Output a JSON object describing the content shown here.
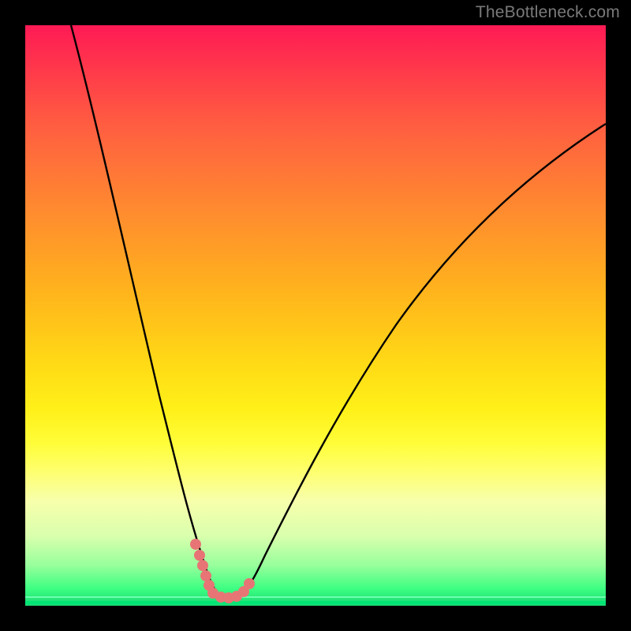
{
  "watermark": "TheBottleneck.com",
  "colors": {
    "curve_stroke": "#000000",
    "marker_fill": "#e77575",
    "background_black": "#000000"
  },
  "chart_data": {
    "type": "line",
    "title": "",
    "xlabel": "",
    "ylabel": "",
    "xlim": [
      0,
      100
    ],
    "ylim": [
      0,
      100
    ],
    "grid": false,
    "legend": false,
    "annotations": [],
    "description": "Bottleneck curve: a V-shaped black curve over a vertical gradient from red (top=high bottleneck) through yellow to green (bottom=optimal). Minimum marked with pink/red segments near x≈34.",
    "series": [
      {
        "name": "left-branch",
        "x": [
          8,
          10,
          12,
          15,
          18,
          20,
          22,
          24,
          26,
          28,
          30,
          31
        ],
        "y": [
          100,
          92,
          83,
          70,
          57,
          48,
          39,
          30,
          21,
          13,
          6,
          3
        ]
      },
      {
        "name": "right-branch",
        "x": [
          37,
          38,
          40,
          43,
          47,
          52,
          58,
          65,
          73,
          82,
          92,
          100
        ],
        "y": [
          3,
          5,
          9,
          15,
          23,
          32,
          42,
          52,
          61,
          70,
          78,
          83
        ]
      },
      {
        "name": "left-markers",
        "x": [
          29.5,
          30.2,
          30.8,
          31.4
        ],
        "y": [
          11,
          8.5,
          6,
          3.5
        ]
      },
      {
        "name": "bottom-markers",
        "x": [
          32,
          33.5,
          35,
          36.5,
          37.5
        ],
        "y": [
          1.5,
          1.2,
          1.2,
          1.5,
          2.5
        ]
      }
    ],
    "minimum_x": 34
  }
}
